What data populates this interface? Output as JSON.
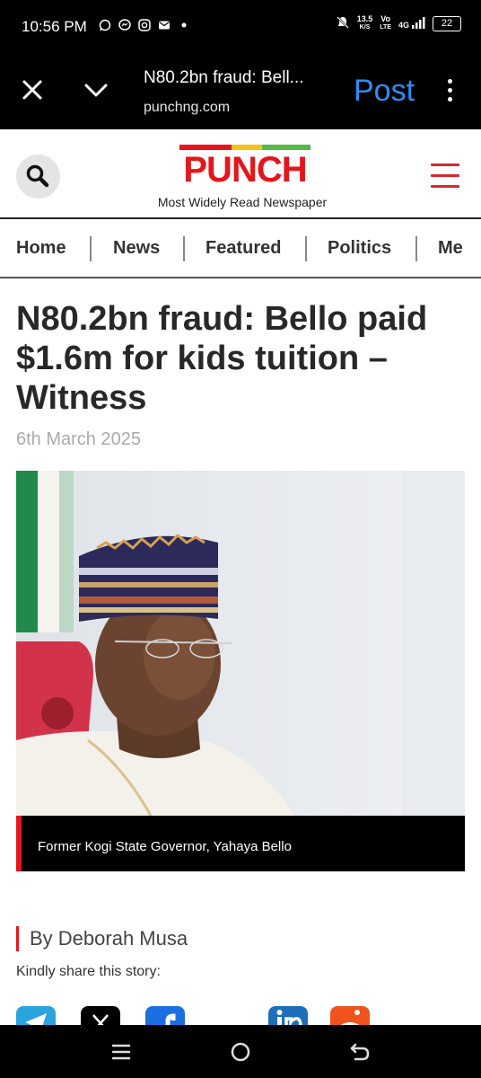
{
  "status_bar": {
    "time": "10:56 PM",
    "speed": "13.5",
    "speed_unit": "K/S",
    "network1": "Vo",
    "network1_sub": "LTE",
    "network2": "4G",
    "battery": "22",
    "icons": [
      "whatsapp-icon",
      "messenger-icon",
      "instagram-icon",
      "mail-icon",
      "dot-icon",
      "mute-icon",
      "signal-icon"
    ]
  },
  "browser": {
    "title": "N80.2bn fraud: Bell...",
    "url": "punchng.com",
    "post_label": "Post"
  },
  "site": {
    "logo_text": "PUNCH",
    "tagline": "Most Widely Read Newspaper",
    "accent": "#e3161b"
  },
  "nav": {
    "items": [
      "Home",
      "News",
      "Featured",
      "Politics",
      "Me"
    ]
  },
  "article": {
    "headline": "N80.2bn fraud: Bello paid $1.6m for kids tuition – Witness",
    "date": "6th March 2025",
    "caption": "Former Kogi State Governor, Yahaya Bello",
    "byline": "By Deborah Musa",
    "share_prompt": "Kindly share this story:",
    "share_icons": [
      "telegram-icon",
      "x-icon",
      "facebook-icon",
      "linkedin-icon",
      "reddit-icon"
    ]
  },
  "system_nav": [
    "recents-icon",
    "home-icon",
    "back-icon"
  ]
}
